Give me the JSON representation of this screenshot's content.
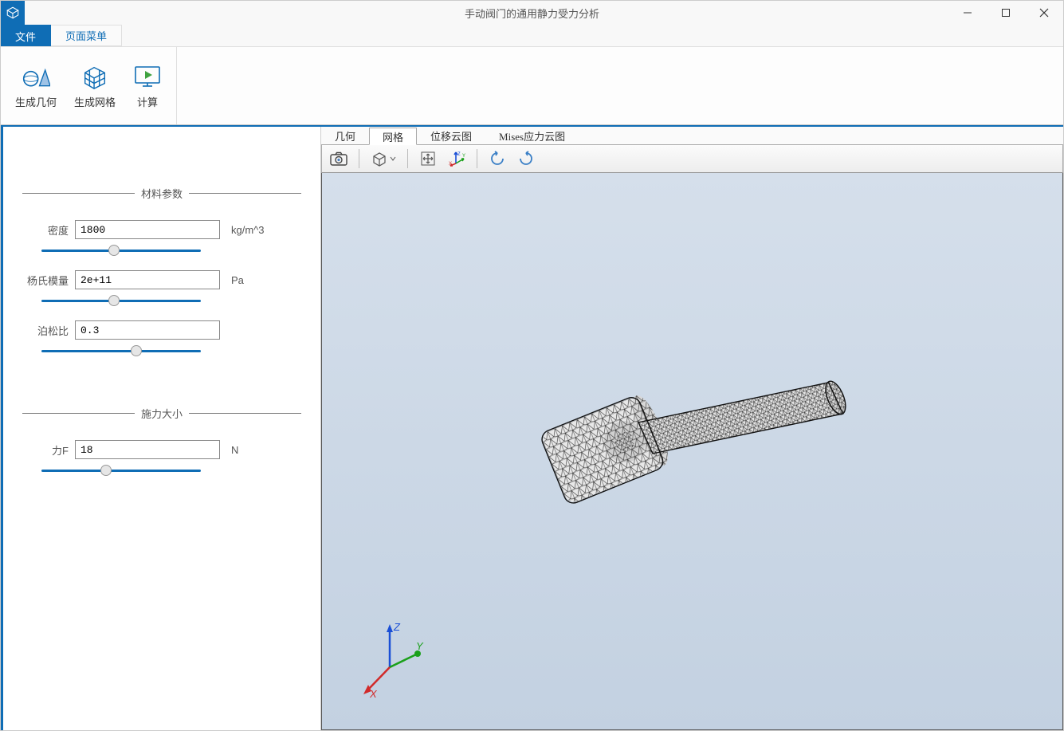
{
  "window": {
    "title": "手动阀门的通用静力受力分析"
  },
  "menutabs": {
    "file": "文件",
    "page": "页面菜单"
  },
  "ribbon": {
    "gen_geometry": "生成几何",
    "gen_mesh": "生成网格",
    "compute": "计算"
  },
  "sidebar": {
    "material_section": "材料参数",
    "density_label": "密度",
    "density_value": "1800",
    "density_unit": "kg/m^3",
    "youngs_label": "杨氏模量",
    "youngs_value": "2e+11",
    "youngs_unit": "Pa",
    "poisson_label": "泊松比",
    "poisson_value": "0.3",
    "force_section": "施力大小",
    "forceF_label": "力F",
    "forceF_value": "18",
    "forceF_unit": "N"
  },
  "viewtabs": {
    "geometry": "几何",
    "mesh": "网格",
    "disp_cloud": "位移云图",
    "mises_cloud": "Mises应力云图"
  },
  "triad": {
    "x": "X",
    "y": "Y",
    "z": "Z"
  }
}
